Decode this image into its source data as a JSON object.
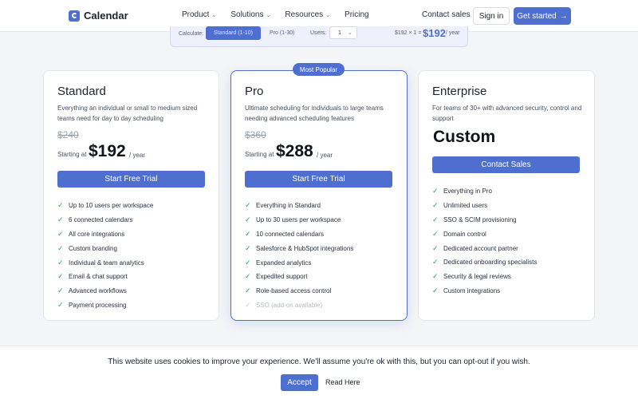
{
  "header": {
    "logo_text": "Calendar",
    "nav": [
      {
        "label": "Product",
        "has_dropdown": true
      },
      {
        "label": "Solutions",
        "has_dropdown": true
      },
      {
        "label": "Resources",
        "has_dropdown": true
      },
      {
        "label": "Pricing",
        "has_dropdown": false
      }
    ],
    "contact_sales": "Contact sales",
    "sign_in": "Sign in",
    "get_started": "Get started",
    "get_started_icon": "arrow-right-icon"
  },
  "calculator": {
    "label": "Calculate:",
    "tab_active": "Standard (1-10)",
    "tab_other": "Pro (1-30)",
    "users_label": "Users:",
    "users_value": "1",
    "equation": "$192 × 1 =",
    "total": "$192",
    "per": "/ year"
  },
  "plans": {
    "standard": {
      "name": "Standard",
      "description": "Everything an individual or small to medium sized teams need for day to day scheduling",
      "old_price": "$240",
      "starting_at": "Starting at",
      "price": "$192",
      "per": "/ year",
      "cta": "Start Free Trial",
      "features": [
        "Up to 10 users per workspace",
        "6 connected calendars",
        "All core integrations",
        "Custom branding",
        "Individual & team analytics",
        "Email & chat support",
        "Advanced workflows",
        "Payment processing"
      ]
    },
    "pro": {
      "badge": "Most Popular",
      "name": "Pro",
      "description": "Ultimate scheduling for individuals to large teams needing advanced scheduling features",
      "old_price": "$360",
      "starting_at": "Starting at",
      "price": "$288",
      "per": "/ year",
      "cta": "Start Free Trial",
      "features": [
        "Everything in Standard",
        "Up to 30 users per workspace",
        "10 connected calendars",
        "Salesforce & HubSpot integrations",
        "Expanded analytics",
        "Expedited support",
        "Role-based access control"
      ],
      "muted_feature": "SSO (add-on available)"
    },
    "enterprise": {
      "name": "Enterprise",
      "description": "For teams of 30+ with advanced security, control and support",
      "price": "Custom",
      "cta": "Contact Sales",
      "features": [
        "Everything in Pro",
        "Unlimited users",
        "SSO & SCIM provisioning",
        "Domain control",
        "Dedicated account partner",
        "Dedicated onboarding specialists",
        "Security & legal reviews",
        "Custom integrations"
      ]
    }
  },
  "cookie": {
    "text": "This website uses cookies to improve your experience. We'll assume you're ok with this, but you can opt-out if you wish.",
    "accept": "Accept",
    "read_here": "Read Here"
  },
  "colors": {
    "accent": "#4f6fd0",
    "check": "#2fa35a",
    "background": "#f4f5f7"
  }
}
